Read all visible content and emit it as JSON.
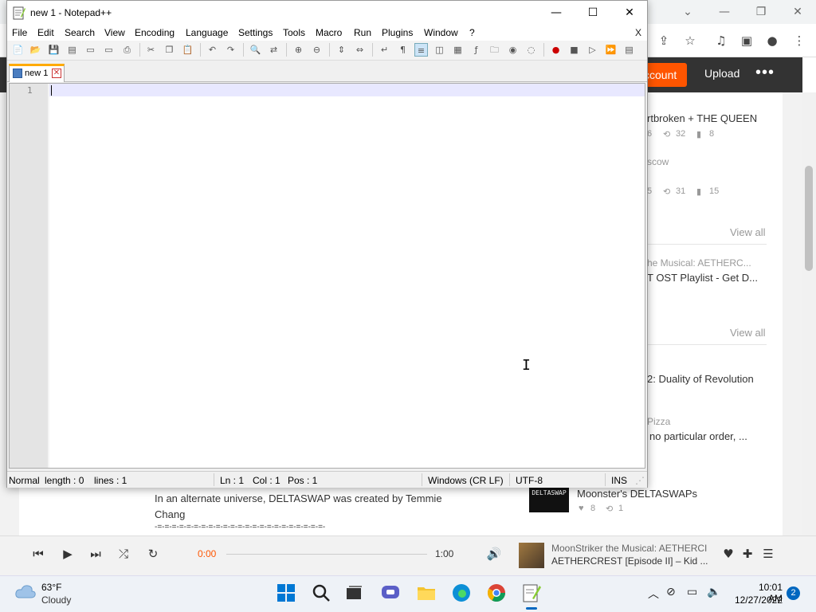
{
  "browser": {
    "soundcloud": {
      "create_account": "ccount",
      "upload": "Upload",
      "more": "•••",
      "sidebar": {
        "track1_title": "rtbroken + THE QUEEN",
        "track1_likes": "6",
        "track1_reposts": "32",
        "track1_comments": "8",
        "track2_title": "scow",
        "track2_likes": "5",
        "track2_reposts": "31",
        "track2_comments": "15",
        "view_all_1": "View all",
        "playlist_title": "he Musical: AETHERC...",
        "playlist_sub": "T OST Playlist - Get D...",
        "view_all_2": "View all",
        "item3_title": "2: Duality of Revolution",
        "item4_title": "Pizza",
        "item4_sub": "no particular order, ...",
        "deltaswap_thumb": "DELTASWAP",
        "deltaswap_title": "Moonster's DELTASWAPs",
        "deltaswap_likes": "8",
        "deltaswap_reposts": "1"
      },
      "description_line1": "In an alternate universe, DELTASWAP was created by Temmie",
      "description_line2": "Chang",
      "description_line3": "-=-=-=-=-=-=-=-=-=-=-=-=-=-=-=-=-=-=-=-=-=-=-=-"
    },
    "player": {
      "elapsed": "0:00",
      "duration": "1:00",
      "track_artist": "MoonStriker the Musical: AETHERCI",
      "track_title": "AETHERCREST [Episode II] – Kid ..."
    }
  },
  "notepad": {
    "window_title": "new 1 - Notepad++",
    "menu": [
      "File",
      "Edit",
      "Search",
      "View",
      "Encoding",
      "Language",
      "Settings",
      "Tools",
      "Macro",
      "Run",
      "Plugins",
      "Window",
      "?"
    ],
    "menu_close": "X",
    "tab_label": "new 1",
    "line_number": "1",
    "status": {
      "mode": "Normal",
      "length": "length : 0",
      "lines": "lines : 1",
      "ln": "Ln : 1",
      "col": "Col : 1",
      "pos": "Pos : 1",
      "eol": "Windows (CR LF)",
      "encoding": "UTF-8",
      "ins": "INS"
    }
  },
  "taskbar": {
    "weather_temp": "63°F",
    "weather_desc": "Cloudy",
    "clock_time": "10:01 AM",
    "clock_date": "12/27/2022",
    "notifications": "2"
  }
}
